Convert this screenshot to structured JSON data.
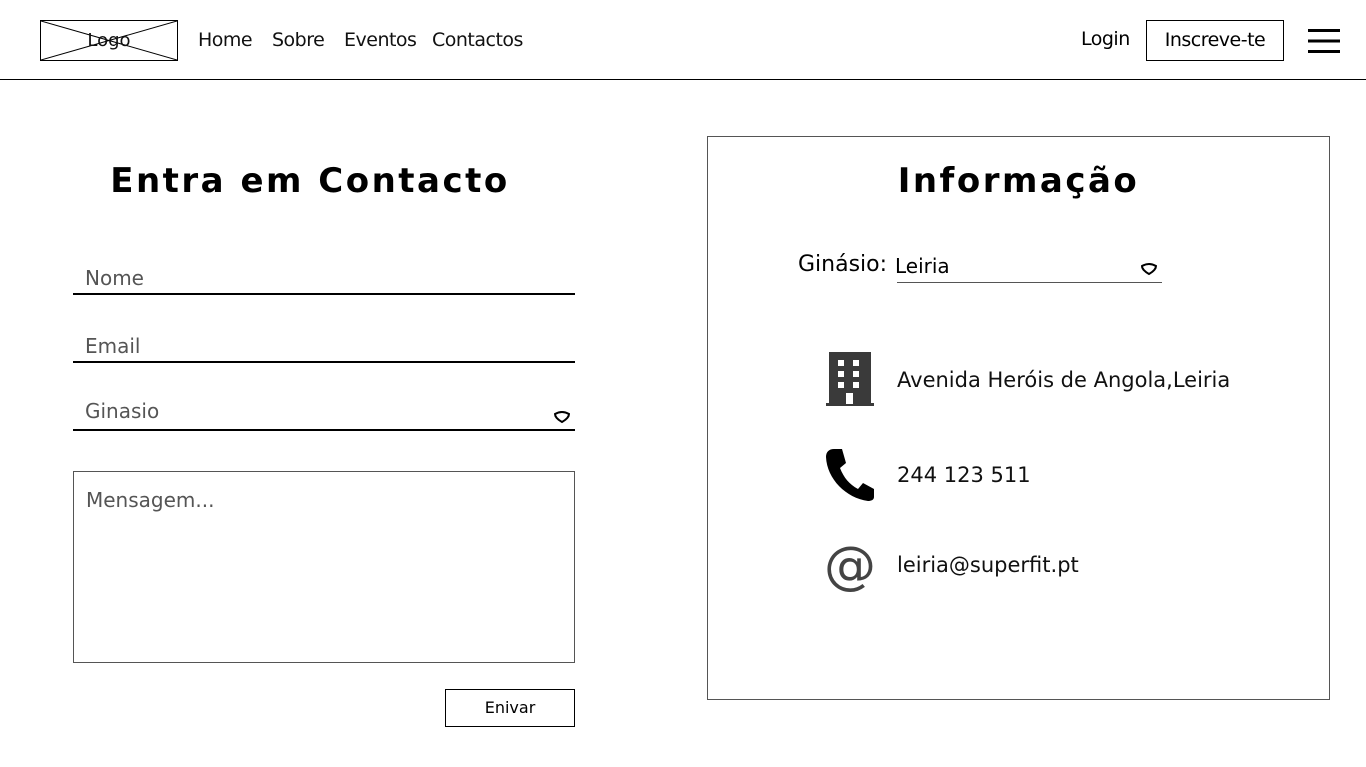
{
  "header": {
    "logo": "Logo",
    "nav": [
      "Home",
      "Sobre",
      "Eventos",
      "Contactos"
    ],
    "login": "Login",
    "signup": "Inscreve-te"
  },
  "form": {
    "title": "Entra em Contacto",
    "name_placeholder": "Nome",
    "email_placeholder": "Email",
    "gym_placeholder": "Ginasio",
    "message_placeholder": "Mensagem...",
    "submit": "Enivar"
  },
  "info": {
    "title": "Informação",
    "gym_label": "Ginásio:",
    "gym_value": "Leiria",
    "address": "Avenida Heróis de Angola,Leiria",
    "phone": "244 123 511",
    "email": "leiria@superfit.pt",
    "at_symbol": "@"
  },
  "icons": {
    "logo": "image-placeholder-icon",
    "menu": "hamburger-menu-icon",
    "dropdown": "chevron-down-icon",
    "address": "building-icon",
    "phone": "phone-icon",
    "email": "at-icon"
  }
}
